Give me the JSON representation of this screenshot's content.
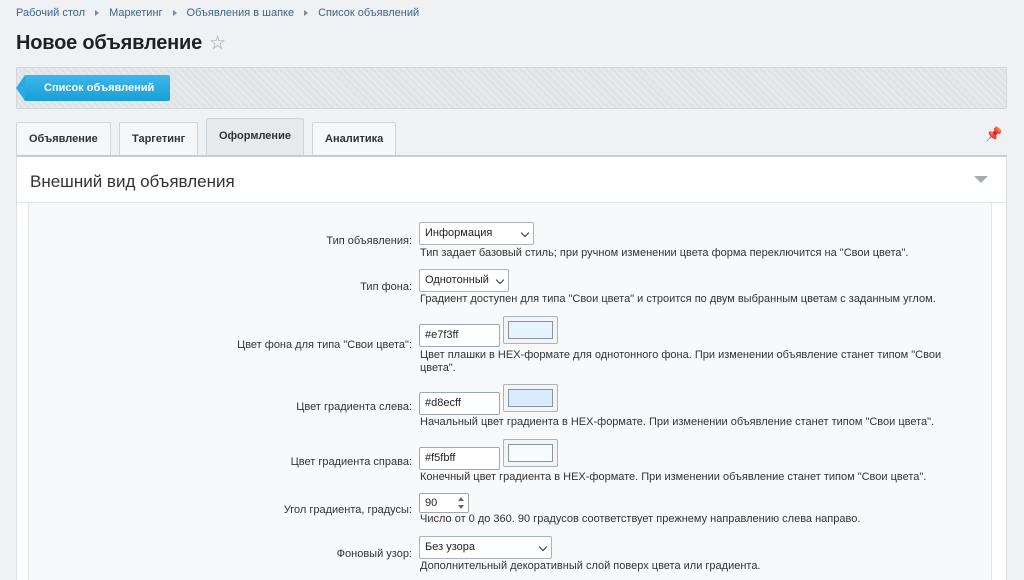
{
  "breadcrumb": [
    "Рабочий стол",
    "Маркетинг",
    "Объявления в шапке",
    "Список объявлений"
  ],
  "page": {
    "title": "Новое объявление"
  },
  "toolbar": {
    "list_button": "Список объявлений"
  },
  "tabs": [
    {
      "label": "Объявление",
      "active": false
    },
    {
      "label": "Таргетинг",
      "active": false
    },
    {
      "label": "Оформление",
      "active": true
    },
    {
      "label": "Аналитика",
      "active": false
    }
  ],
  "section": {
    "title": "Внешний вид объявления"
  },
  "form": {
    "type": {
      "label": "Тип объявления:",
      "value": "Информация",
      "hint": "Тип задает базовый стиль; при ручном изменении цвета форма переключится на \"Свои цвета\"."
    },
    "bg_type": {
      "label": "Тип фона:",
      "value": "Однотонный",
      "hint": "Градиент доступен для типа \"Свои цвета\" и строится по двум выбранным цветам с заданным углом."
    },
    "bg_color": {
      "label": "Цвет фона для типа \"Свои цвета\":",
      "value": "#e7f3ff",
      "swatch": "#e7f3ff",
      "hint": "Цвет плашки в HEX-формате для однотонного фона. При изменении объявление станет типом \"Свои цвета\"."
    },
    "gradient_left": {
      "label": "Цвет градиента слева:",
      "value": "#d8ecff",
      "swatch": "#d8ecff",
      "hint": "Начальный цвет градиента в HEX-формате. При изменении объявление станет типом \"Свои цвета\"."
    },
    "gradient_right": {
      "label": "Цвет градиента справа:",
      "value": "#f5fbff",
      "swatch": "#f5fbff",
      "hint": "Конечный цвет градиента в HEX-формате. При изменении объявление станет типом \"Свои цвета\"."
    },
    "gradient_angle": {
      "label": "Угол градиента, градусы:",
      "value": "90",
      "hint": "Число от 0 до 360. 90 градусов соответствует прежнему направлению слева направо."
    },
    "pattern": {
      "label": "Фоновый узор:",
      "value": "Без узора",
      "hint": "Дополнительный декоративный слой поверх цвета или градиента."
    }
  }
}
